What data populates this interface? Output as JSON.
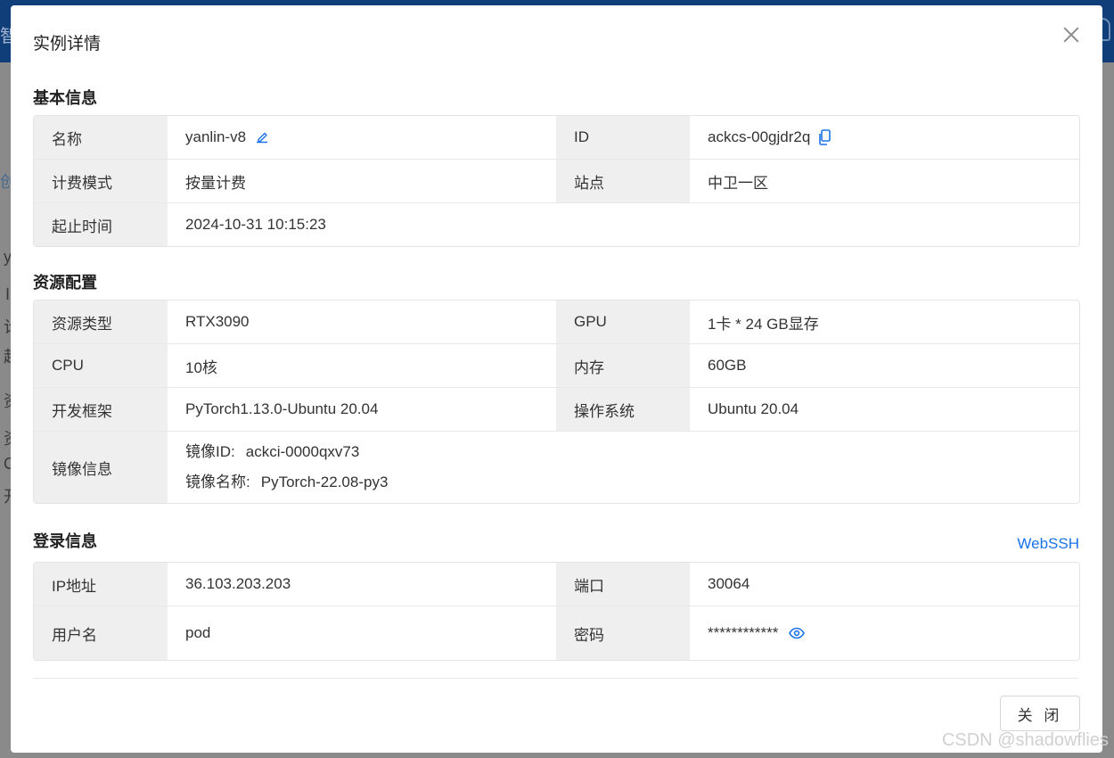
{
  "dialog": {
    "title": "实例详情",
    "close_button_label": "关 闭"
  },
  "background": {
    "fragments": [
      "智",
      "创",
      "y",
      "I",
      "计",
      "起",
      "资",
      "资",
      "C",
      "开"
    ]
  },
  "basic_info": {
    "title": "基本信息",
    "rows": [
      {
        "label": "名称",
        "value": "yanlin-v8",
        "label2": "ID",
        "value2": "ackcs-00gjdr2q"
      },
      {
        "label": "计费模式",
        "value": "按量计费",
        "label2": "站点",
        "value2": "中卫一区"
      },
      {
        "label": "起止时间",
        "value": "2024-10-31 10:15:23"
      }
    ]
  },
  "resources": {
    "title": "资源配置",
    "rows": [
      {
        "label": "资源类型",
        "value": "RTX3090",
        "label2": "GPU",
        "value2": "1卡 * 24 GB显存"
      },
      {
        "label": "CPU",
        "value": "10核",
        "label2": "内存",
        "value2": "60GB"
      },
      {
        "label": "开发框架",
        "value": "PyTorch1.13.0-Ubuntu 20.04",
        "label2": "操作系统",
        "value2": "Ubuntu 20.04"
      }
    ],
    "image": {
      "label": "镜像信息",
      "id_label": "镜像ID:",
      "id_value": "ackci-0000qxv73",
      "name_label": "镜像名称:",
      "name_value": "PyTorch-22.08-py3"
    }
  },
  "login": {
    "title": "登录信息",
    "webssh_label": "WebSSH",
    "rows": [
      {
        "label": "IP地址",
        "value": "36.103.203.203",
        "label2": "端口",
        "value2": "30064"
      },
      {
        "label": "用户名",
        "value": "pod",
        "label2": "密码",
        "value2": "************"
      }
    ]
  },
  "watermark": "CSDN @shadowflies",
  "icons": {
    "edit": "edit-icon",
    "copy": "copy-icon",
    "eye": "eye-icon",
    "close": "close-icon"
  },
  "colors": {
    "accent": "#1a73e8",
    "header": "#0f3e78",
    "label_bg": "#efefef"
  }
}
